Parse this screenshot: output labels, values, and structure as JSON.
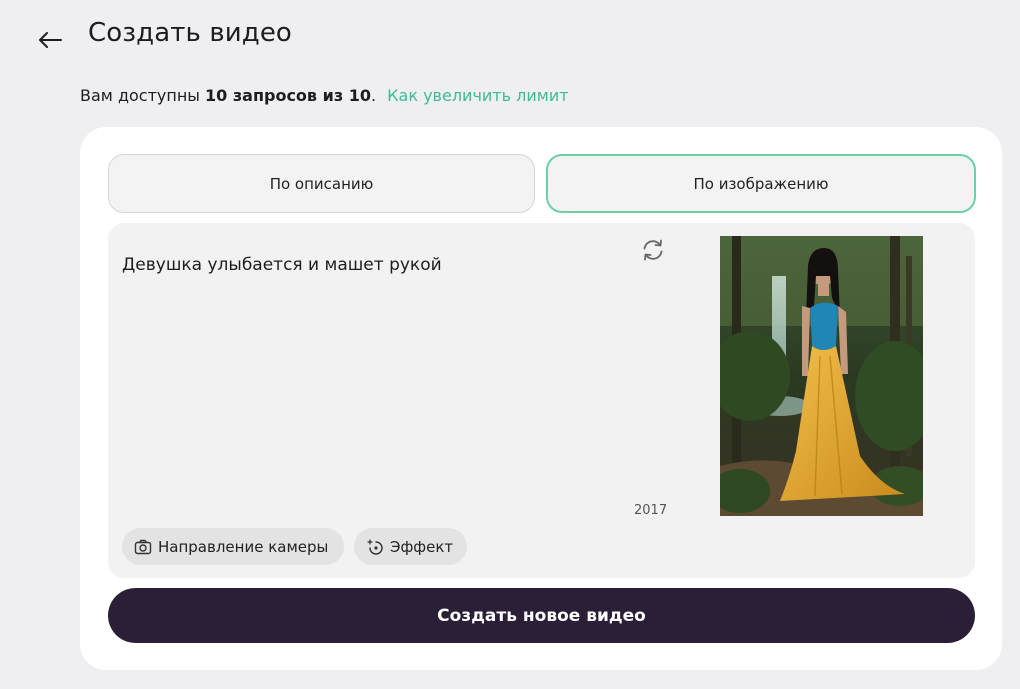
{
  "header": {
    "back_icon": "arrow-left-icon",
    "title": "Создать видео"
  },
  "limit": {
    "prefix": "Вам доступны ",
    "count": "10 запросов из 10",
    "suffix": ".",
    "link": "Как увеличить лимит"
  },
  "tabs": [
    {
      "label": "По описанию",
      "active": false
    },
    {
      "label": "По изображению",
      "active": true
    }
  ],
  "prompt": {
    "text": "Девушка улыбается и машет рукой",
    "refresh_icon": "refresh-icon",
    "char_count": "2017",
    "image_description_icon": "uploaded-image-preview"
  },
  "chips": [
    {
      "label": "Направление камеры",
      "icon": "camera-icon"
    },
    {
      "label": "Эффект",
      "icon": "sparkle-effect-icon"
    }
  ],
  "create_button": {
    "label": "Создать новое видео"
  },
  "colors": {
    "accent": "#3dbb93",
    "tab_active_border": "#6ccfa8",
    "primary_button": "#2b1f38",
    "page_bg": "#efeff1"
  }
}
